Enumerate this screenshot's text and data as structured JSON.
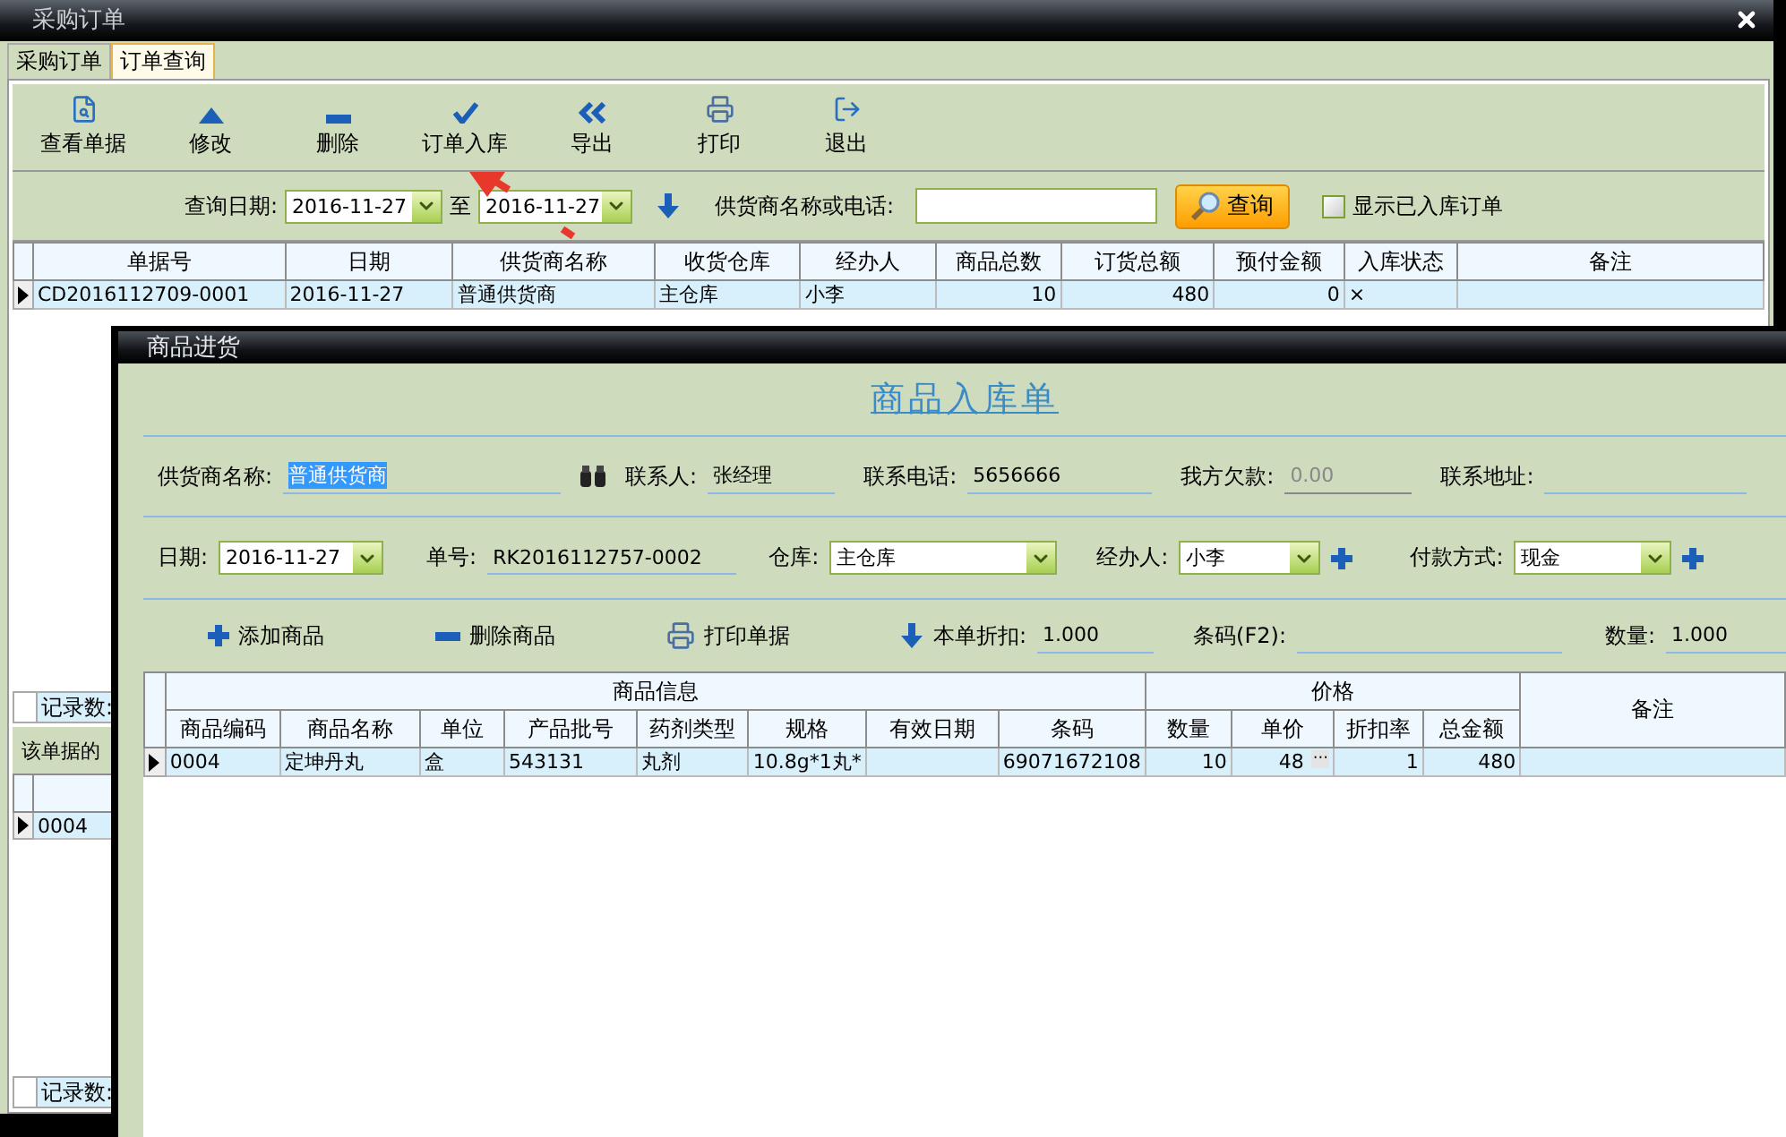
{
  "window": {
    "title": "采购订单"
  },
  "tabs": [
    {
      "label": "采购订单",
      "selected": false
    },
    {
      "label": "订单查询",
      "selected": true
    }
  ],
  "toolbar": [
    {
      "label": "查看单据",
      "kind": "view"
    },
    {
      "label": "修改",
      "kind": "up"
    },
    {
      "label": "删除",
      "kind": "minus"
    },
    {
      "label": "订单入库",
      "kind": "check"
    },
    {
      "label": "导出",
      "kind": "rewind"
    },
    {
      "label": "打印",
      "kind": "print"
    },
    {
      "label": "退出",
      "kind": "exit"
    }
  ],
  "filter": {
    "date_label": "查询日期:",
    "date_from": "2016-11-27",
    "to_label": "至",
    "date_to": "2016-11-27",
    "supplier_label": "供货商名称或电话:",
    "query_button": "查询",
    "show_stocked": {
      "label": "显示已入库订单",
      "checked": false
    }
  },
  "orders": {
    "columns": [
      {
        "label": "单据号",
        "kind": "text"
      },
      {
        "label": "日期",
        "kind": "text"
      },
      {
        "label": "供货商名称",
        "kind": "text"
      },
      {
        "label": "收货仓库",
        "kind": "text"
      },
      {
        "label": "经办人",
        "kind": "text"
      },
      {
        "label": "商品总数",
        "kind": "number"
      },
      {
        "label": "订货总额",
        "kind": "number"
      },
      {
        "label": "预付金额",
        "kind": "number"
      },
      {
        "label": "入库状态",
        "kind": "text"
      },
      {
        "label": "备注",
        "kind": "text"
      }
    ],
    "rows": [
      {
        "current": true,
        "cells": [
          "CD2016112709-0001",
          "2016-11-27",
          "普通供货商",
          "主仓库",
          "小李",
          "10",
          "480",
          "0",
          "×",
          ""
        ]
      }
    ],
    "footer": "记录数:"
  },
  "details": {
    "caption": "该单据的",
    "rows": [
      {
        "current": true,
        "cells": [
          "0004"
        ]
      }
    ],
    "footer": "记录数:"
  },
  "dialog": {
    "title": "商品进货",
    "heading": "商品入库单",
    "supplier": {
      "label": "供货商名称:",
      "value": "普通供货商",
      "highlighted": true
    },
    "contact": {
      "label": "联系人:",
      "value": "张经理"
    },
    "phone": {
      "label": "联系电话:",
      "value": "5656666"
    },
    "debt": {
      "label": "我方欠款:",
      "value": "0.00",
      "disabled": true
    },
    "address": {
      "label": "联系地址:"
    },
    "date": {
      "label": "日期:",
      "value": "2016-11-27"
    },
    "number": {
      "label": "单号:",
      "value": "RK2016112757-0002"
    },
    "warehouse": {
      "label": "仓库:",
      "value": "主仓库"
    },
    "handler": {
      "label": "经办人:",
      "value": "小李"
    },
    "payment": {
      "label": "付款方式:",
      "value": "现金"
    },
    "actions": [
      {
        "label": "添加商品",
        "kind": "add"
      },
      {
        "label": "删除商品",
        "kind": "minus"
      },
      {
        "label": "打印单据",
        "kind": "print"
      }
    ],
    "discount": {
      "label": "本单折扣:",
      "value": "1.000"
    },
    "barcode": {
      "label": "条码(F2):"
    },
    "quantity": {
      "label": "数量:",
      "value": "1.000"
    },
    "groups": [
      {
        "label": "商品信息"
      },
      {
        "label": "价格"
      }
    ],
    "remark_header": "备注",
    "columns": [
      {
        "label": "商品编码",
        "kind": "text"
      },
      {
        "label": "商品名称",
        "kind": "text"
      },
      {
        "label": "单位",
        "kind": "text"
      },
      {
        "label": "产品批号",
        "kind": "text"
      },
      {
        "label": "药剂类型",
        "kind": "text"
      },
      {
        "label": "规格",
        "kind": "text"
      },
      {
        "label": "有效日期",
        "kind": "text"
      },
      {
        "label": "条码",
        "kind": "text"
      },
      {
        "label": "数量",
        "kind": "number"
      },
      {
        "label": "单价",
        "kind": "picker"
      },
      {
        "label": "折扣率",
        "kind": "number"
      },
      {
        "label": "总金额",
        "kind": "number"
      }
    ],
    "rows": [
      {
        "current": true,
        "cells": [
          "0004",
          "定坤丹丸",
          "盒",
          "543131",
          "丸剂",
          "10.8g*1丸*",
          "",
          "69071672108",
          "10",
          "48",
          "1",
          "480",
          ""
        ],
        "picker": "···"
      }
    ]
  }
}
